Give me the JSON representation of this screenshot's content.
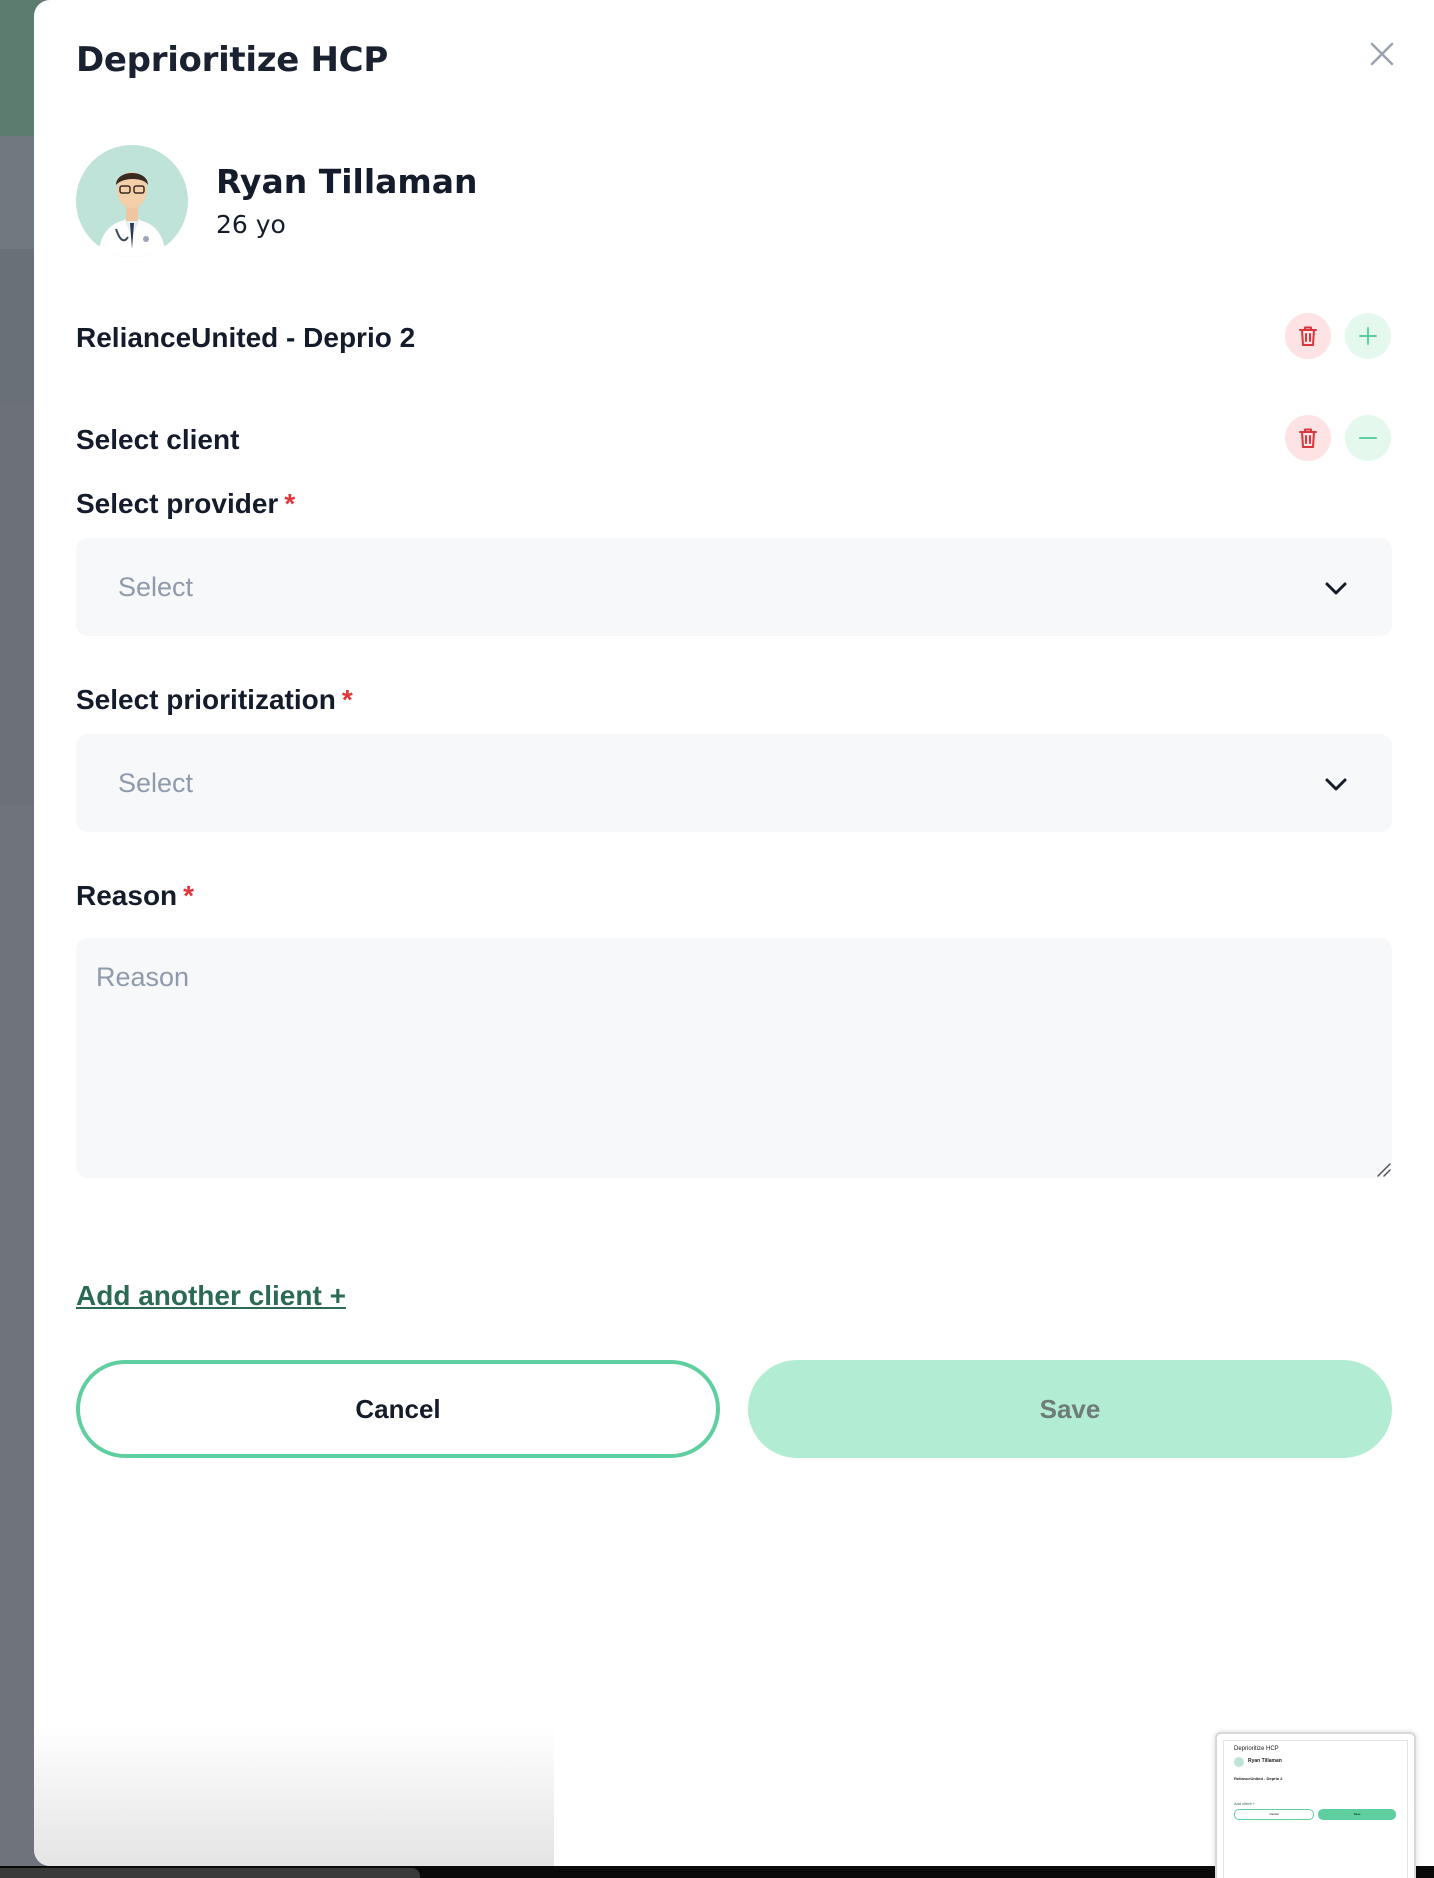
{
  "modal": {
    "title": "Deprioritize HCP"
  },
  "patient": {
    "name": "Ryan Tillaman",
    "age": "26 yo"
  },
  "client_blocks": [
    {
      "title": "RelianceUnited - Deprio 2"
    },
    {
      "title": "Select client"
    }
  ],
  "form": {
    "provider": {
      "label": "Select provider",
      "required_mark": "*",
      "placeholder": "Select"
    },
    "prioritization": {
      "label": "Select prioritization",
      "required_mark": "*",
      "placeholder": "Select"
    },
    "reason": {
      "label": "Reason",
      "required_mark": "*",
      "placeholder": "Reason"
    }
  },
  "actions": {
    "add_client_link": "Add another client +",
    "cancel_label": "Cancel",
    "save_label": "Save"
  },
  "thumbnail": {
    "title": "Deprioritize HCP",
    "name": "Ryan Tillaman",
    "client": "RelianceUnited - Deprio 2",
    "link": "Add client +",
    "cancel": "Cancel",
    "save": "Save"
  },
  "colors": {
    "accent_green": "#5fcf9f",
    "save_disabled_bg": "#b2ecd3",
    "delete_red": "#d9363e",
    "link_green": "#2b6b55"
  },
  "icons": {
    "close": "close-icon",
    "trash": "trash-icon",
    "plus": "plus-icon",
    "minus": "minus-icon",
    "chevron": "chevron-down-icon"
  }
}
